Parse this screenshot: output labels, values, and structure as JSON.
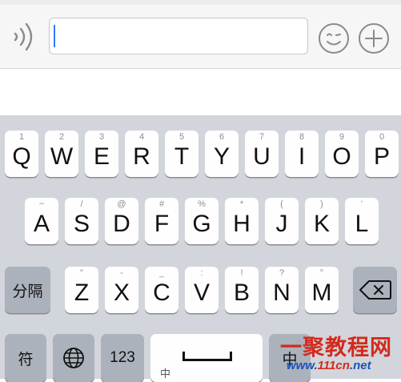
{
  "input_bar": {
    "voice_icon": "voice-waves-icon",
    "text_value": "",
    "emoji_icon": "smiley-wink-icon",
    "plus_icon": "plus-circle-icon"
  },
  "keyboard": {
    "row1": [
      {
        "hint": "1",
        "label": "Q"
      },
      {
        "hint": "2",
        "label": "W"
      },
      {
        "hint": "3",
        "label": "E"
      },
      {
        "hint": "4",
        "label": "R"
      },
      {
        "hint": "5",
        "label": "T"
      },
      {
        "hint": "6",
        "label": "Y"
      },
      {
        "hint": "7",
        "label": "U"
      },
      {
        "hint": "8",
        "label": "I"
      },
      {
        "hint": "9",
        "label": "O"
      },
      {
        "hint": "0",
        "label": "P"
      }
    ],
    "row2": [
      {
        "hint": "~",
        "label": "A"
      },
      {
        "hint": "/",
        "label": "S"
      },
      {
        "hint": "@",
        "label": "D"
      },
      {
        "hint": "#",
        "label": "F"
      },
      {
        "hint": "%",
        "label": "G"
      },
      {
        "hint": "*",
        "label": "H"
      },
      {
        "hint": "(",
        "label": "J"
      },
      {
        "hint": ")",
        "label": "K"
      },
      {
        "hint": "'",
        "label": "L"
      }
    ],
    "row3": [
      {
        "hint": "\"",
        "label": "Z"
      },
      {
        "hint": "-",
        "label": "X"
      },
      {
        "hint": "_",
        "label": "C"
      },
      {
        "hint": ":",
        "label": "V"
      },
      {
        "hint": "!",
        "label": "B"
      },
      {
        "hint": "?",
        "label": "N"
      },
      {
        "hint": "°",
        "label": "M"
      }
    ],
    "separator_label": "分隔",
    "backspace_icon": "backspace-icon",
    "symbol_label": "符",
    "globe_icon": "globe-icon",
    "numbers_label": "123",
    "space_sub_label": "中",
    "space_icon": "space-bar-icon",
    "switch_label": "中"
  },
  "watermark": {
    "main_text": "一聚教程网",
    "sub_text_prefix": "www.",
    "sub_text_brand": "111cn",
    "sub_text_suffix": ".net"
  }
}
